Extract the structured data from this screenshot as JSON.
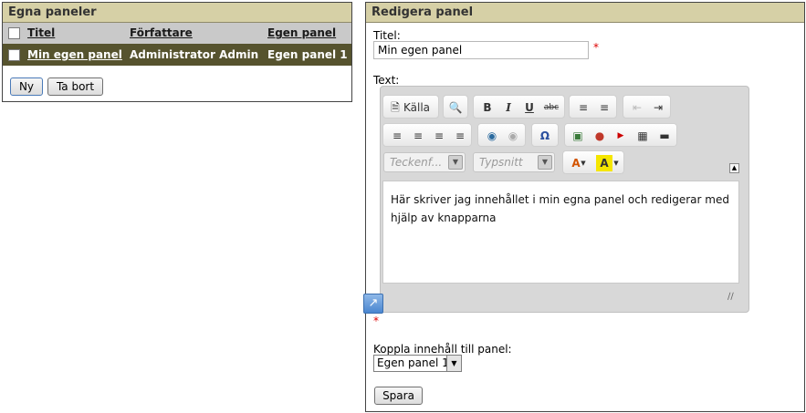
{
  "left_panel": {
    "title": "Egna paneler",
    "columns": {
      "title": "Titel",
      "author": "Författare",
      "panel": "Egen panel"
    },
    "rows": [
      {
        "title": "Min egen panel",
        "author": "Administrator Admin",
        "panel": "Egen panel 1"
      }
    ],
    "new_button": "Ny",
    "delete_button": "Ta bort"
  },
  "right_panel": {
    "title": "Redigera panel",
    "title_label": "Titel:",
    "title_value": "Min egen panel",
    "required_mark": "*",
    "text_label": "Text:",
    "toolbar": {
      "source_label": "Källa",
      "bold": "B",
      "italic": "I",
      "underline": "U",
      "strike": "abc",
      "format_placeholder": "Teckenf...",
      "font_placeholder": "Typsnitt",
      "text_color": "A",
      "bg_color": "A"
    },
    "editor_content": "Här skriver jag innehållet i min egna panel och redigerar med hjälp av knapparna",
    "link_label": "Koppla innehåll till panel:",
    "link_selected": "Egen panel 1",
    "save_button": "Spara"
  }
}
